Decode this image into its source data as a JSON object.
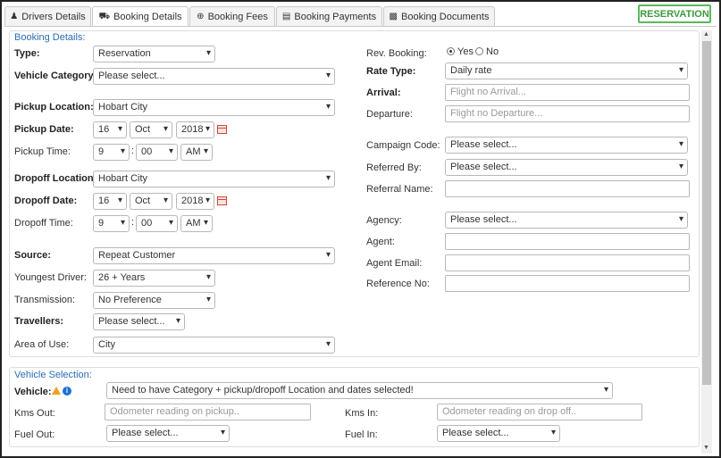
{
  "tabs": [
    {
      "label": "Drivers Details",
      "icon": "user-icon"
    },
    {
      "label": "Booking Details",
      "icon": "car-icon"
    },
    {
      "label": "Booking Fees",
      "icon": "plus-circle-icon"
    },
    {
      "label": "Booking Payments",
      "icon": "credit-card-icon"
    },
    {
      "label": "Booking Documents",
      "icon": "document-icon"
    }
  ],
  "status_badge": "RESERVATION",
  "booking": {
    "section_title": "Booking Details:",
    "type": {
      "label": "Type:",
      "value": "Reservation"
    },
    "vehicle_category": {
      "label": "Vehicle Category:",
      "value": "Please select..."
    },
    "pickup_location": {
      "label": "Pickup Location:",
      "value": "Hobart City"
    },
    "pickup_date": {
      "label": "Pickup Date:",
      "day": "16",
      "month": "Oct",
      "year": "2018"
    },
    "pickup_time": {
      "label": "Pickup Time:",
      "hour": "9",
      "minute": "00",
      "ampm": "AM"
    },
    "dropoff_location": {
      "label": "Dropoff Location:",
      "value": "Hobart City"
    },
    "dropoff_date": {
      "label": "Dropoff Date:",
      "day": "16",
      "month": "Oct",
      "year": "2018"
    },
    "dropoff_time": {
      "label": "Dropoff Time:",
      "hour": "9",
      "minute": "00",
      "ampm": "AM"
    },
    "source": {
      "label": "Source:",
      "value": "Repeat Customer"
    },
    "youngest_driver": {
      "label": "Youngest Driver:",
      "value": "26 + Years"
    },
    "transmission": {
      "label": "Transmission:",
      "value": "No Preference"
    },
    "travellers": {
      "label": "Travellers:",
      "value": "Please select..."
    },
    "area_of_use": {
      "label": "Area of Use:",
      "value": "City"
    },
    "rev_booking": {
      "label": "Rev. Booking:",
      "yes": "Yes",
      "no": "No",
      "selected": "Yes"
    },
    "rate_type": {
      "label": "Rate Type:",
      "value": "Daily rate"
    },
    "arrival": {
      "label": "Arrival:",
      "placeholder": "Flight no Arrival..."
    },
    "departure": {
      "label": "Departure:",
      "placeholder": "Flight no Departure..."
    },
    "campaign_code": {
      "label": "Campaign Code:",
      "value": "Please select..."
    },
    "referred_by": {
      "label": "Referred By:",
      "value": "Please select..."
    },
    "referral_name": {
      "label": "Referral Name:",
      "value": ""
    },
    "agency": {
      "label": "Agency:",
      "value": "Please select..."
    },
    "agent": {
      "label": "Agent:",
      "value": ""
    },
    "agent_email": {
      "label": "Agent Email:",
      "value": ""
    },
    "reference_no": {
      "label": "Reference No:",
      "value": ""
    }
  },
  "vehicle_selection": {
    "section_title": "Vehicle Selection:",
    "vehicle": {
      "label": "Vehicle:",
      "value": "Need to have Category + pickup/dropoff Location and dates selected!"
    },
    "kms_out": {
      "label": "Kms Out:",
      "placeholder": "Odometer reading on pickup.."
    },
    "kms_in": {
      "label": "Kms In:",
      "placeholder": "Odometer reading on drop off.."
    },
    "fuel_out": {
      "label": "Fuel Out:",
      "value": "Please select..."
    },
    "fuel_in": {
      "label": "Fuel In:",
      "value": "Please select..."
    }
  },
  "colors": {
    "accent": "#2a6db5",
    "status_green": "#5cb85c",
    "calendar_red": "#d04a3a",
    "warning": "#f0a020",
    "info": "#1f6fd0"
  }
}
